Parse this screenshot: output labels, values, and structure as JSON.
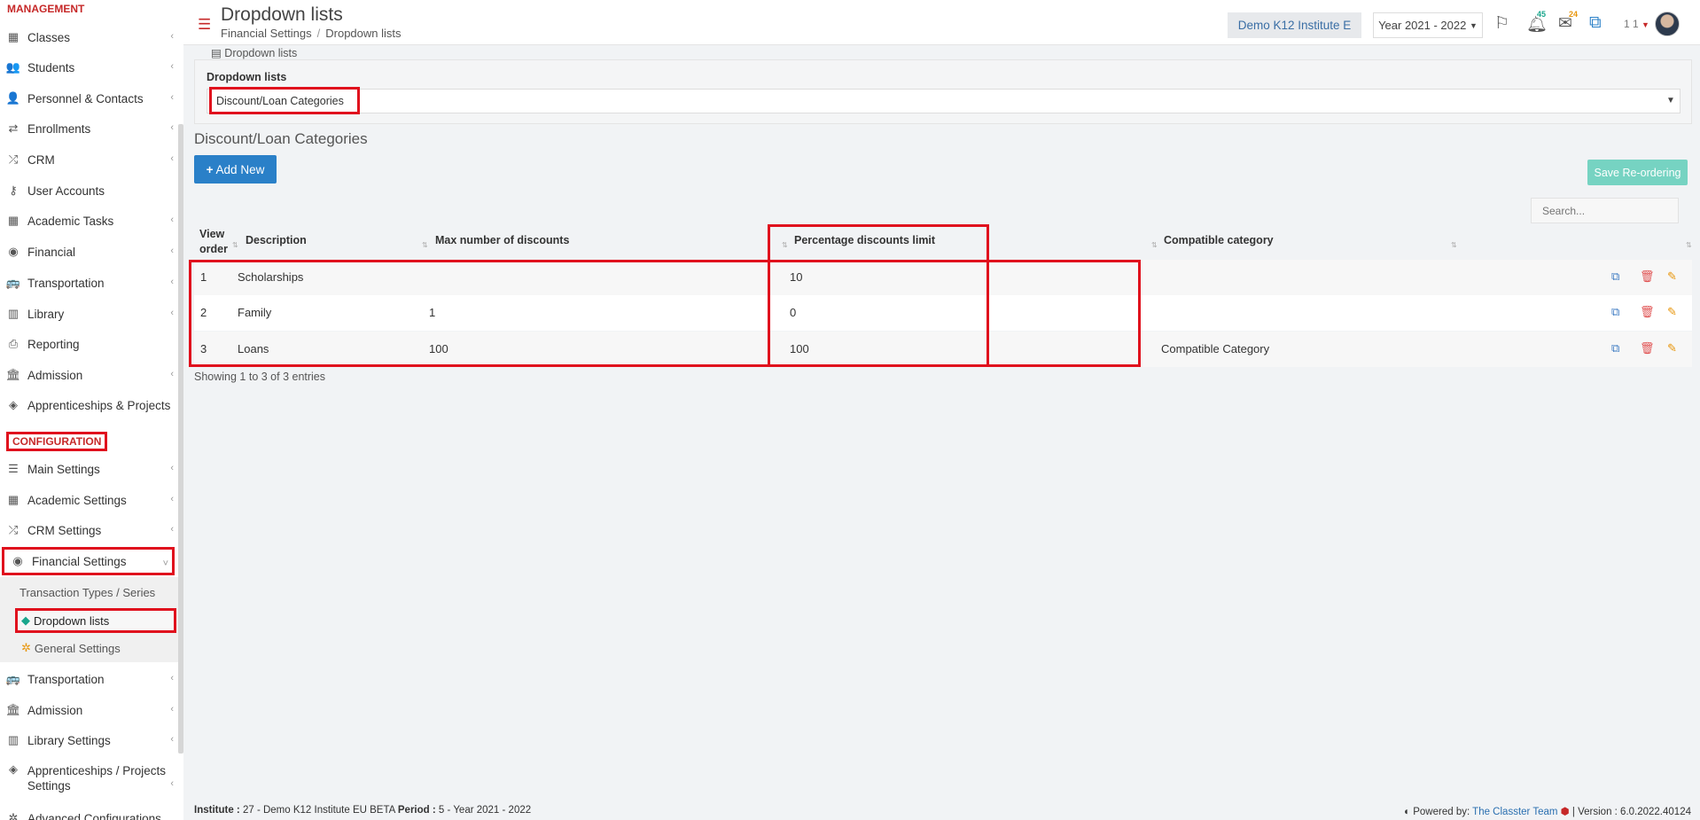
{
  "sidebar": {
    "management_heading": "MANAGEMENT",
    "management_items": [
      {
        "label": "Classes",
        "icon": "classes-icon"
      },
      {
        "label": "Students",
        "icon": "students-icon"
      },
      {
        "label": "Personnel & Contacts",
        "icon": "personnel-icon"
      },
      {
        "label": "Enrollments",
        "icon": "enrollments-icon"
      },
      {
        "label": "CRM",
        "icon": "crm-icon"
      },
      {
        "label": "User Accounts",
        "icon": "key-icon"
      },
      {
        "label": "Academic Tasks",
        "icon": "grid-icon"
      },
      {
        "label": "Financial",
        "icon": "coins-icon"
      },
      {
        "label": "Transportation",
        "icon": "bus-icon"
      },
      {
        "label": "Library",
        "icon": "library-icon"
      },
      {
        "label": "Reporting",
        "icon": "printer-icon"
      },
      {
        "label": "Admission",
        "icon": "bank-icon"
      },
      {
        "label": "Apprenticeships & Projects",
        "icon": "box-icon"
      }
    ],
    "configuration_heading": "CONFIGURATION",
    "configuration_items": [
      {
        "label": "Main Settings",
        "icon": "sliders-icon"
      },
      {
        "label": "Academic Settings",
        "icon": "classes-icon"
      },
      {
        "label": "CRM Settings",
        "icon": "crm-icon"
      },
      {
        "label": "Financial Settings",
        "icon": "coins-icon"
      }
    ],
    "financial_sub_items": [
      "Transaction Types / Series",
      "Dropdown lists",
      "General Settings"
    ],
    "configuration_items_after": [
      {
        "label": "Transportation",
        "icon": "bus-icon"
      },
      {
        "label": "Admission",
        "icon": "bank-icon"
      },
      {
        "label": "Library Settings",
        "icon": "library-icon"
      },
      {
        "label": "Apprenticeships / Projects Settings",
        "icon": "box-icon"
      },
      {
        "label": "Advanced Configurations",
        "icon": "gears-icon"
      }
    ]
  },
  "header": {
    "title": "Dropdown lists",
    "breadcrumb": [
      "Financial Settings",
      "Dropdown lists"
    ],
    "institute": "Demo K12 Institute E",
    "year": "Year 2021 - 2022",
    "notifications_count": "45",
    "messages_count": "24",
    "user_number": "1 1"
  },
  "panel": {
    "title": "Dropdown lists",
    "label": "Dropdown lists",
    "selected": "Discount/Loan Categories"
  },
  "section_title": "Discount/Loan Categories",
  "buttons": {
    "add_new": "Add New",
    "save_reordering": "Save Re-ordering"
  },
  "search": {
    "placeholder": "Search..."
  },
  "table": {
    "columns": [
      "View order",
      "Description",
      "Max number of discounts",
      "Percentage discounts limit",
      "Compatible category"
    ],
    "rows": [
      {
        "order": "1",
        "description": "Scholarships",
        "max": "",
        "pct": "10",
        "compat": ""
      },
      {
        "order": "2",
        "description": "Family",
        "max": "1",
        "pct": "0",
        "compat": ""
      },
      {
        "order": "3",
        "description": "Loans",
        "max": "100",
        "pct": "100",
        "compat": "Compatible Category"
      }
    ],
    "entries_info": "Showing 1 to 3 of 3 entries"
  },
  "footer": {
    "institute_label": "Institute :",
    "institute_value": "27 - Demo K12 Institute EU BETA",
    "period_label": "Period :",
    "period_value": "5 - Year 2021 - 2022",
    "powered_by": "Powered by:",
    "team": "The Classter Team",
    "version": "| Version : 6.0.2022.40124"
  },
  "colors": {
    "accent_red": "#c62828",
    "highlight_red": "#e0101d",
    "primary_blue": "#2a80c8",
    "teal": "#76d3c2"
  }
}
